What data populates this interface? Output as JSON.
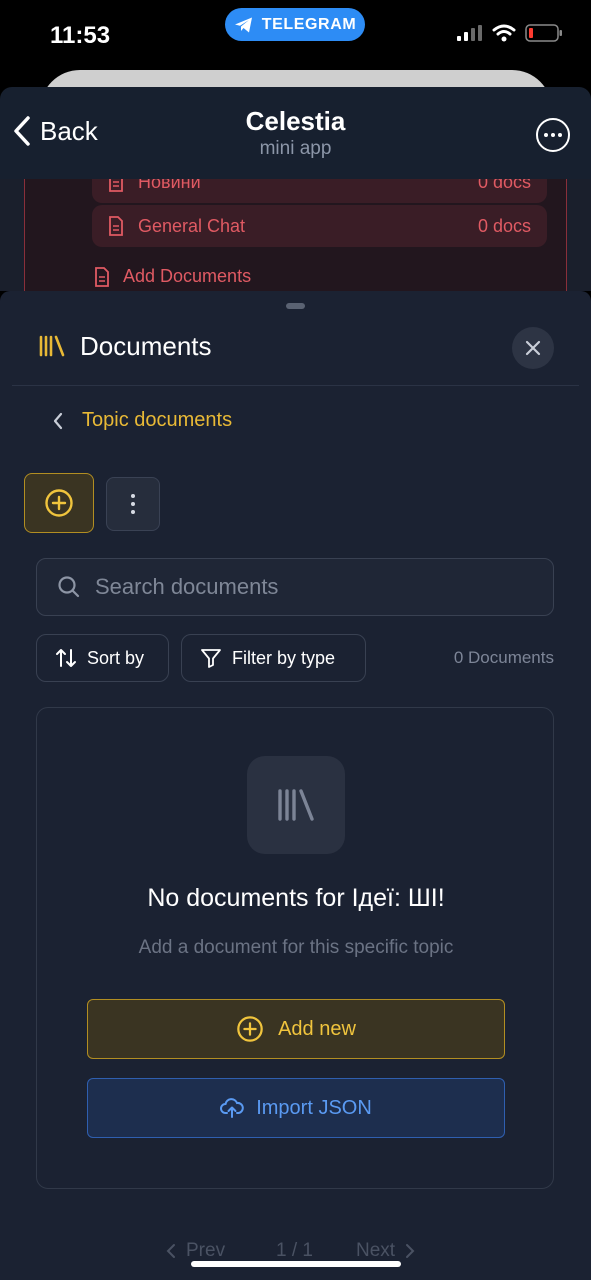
{
  "status_bar": {
    "time": "11:53",
    "pill_label": "TELEGRAM"
  },
  "header": {
    "back_label": "Back",
    "title": "Celestia",
    "subtitle": "mini app"
  },
  "background_list": {
    "partial_row_label": "Новини",
    "partial_row_count": "0 docs",
    "row_label": "General Chat",
    "row_count": "0 docs",
    "add_label": "Add Documents"
  },
  "sheet": {
    "title": "Documents",
    "breadcrumb": "Topic documents",
    "search_placeholder": "Search documents",
    "sort_label": "Sort by",
    "filter_label": "Filter by type",
    "doc_count": "0 Documents",
    "empty_title": "No documents for Ідеї: ШІ!",
    "empty_subtitle": "Add a document for this specific topic",
    "add_new_label": "Add new",
    "import_label": "Import JSON",
    "pager": {
      "prev": "Prev",
      "page": "1 / 1",
      "next": "Next"
    }
  },
  "colors": {
    "accent": "#e8b936",
    "import_blue": "#5a9af2",
    "danger": "#e05a63",
    "sheet_bg": "#1b2232"
  },
  "icons": [
    "telegram-icon",
    "signal-icon",
    "wifi-icon",
    "battery-icon",
    "chevron-left-icon",
    "more-icon",
    "document-icon",
    "library-icon",
    "close-icon",
    "plus-circle-icon",
    "vertical-dots-icon",
    "search-icon",
    "sort-icon",
    "filter-icon",
    "cloud-upload-icon",
    "chevron-right-icon"
  ]
}
